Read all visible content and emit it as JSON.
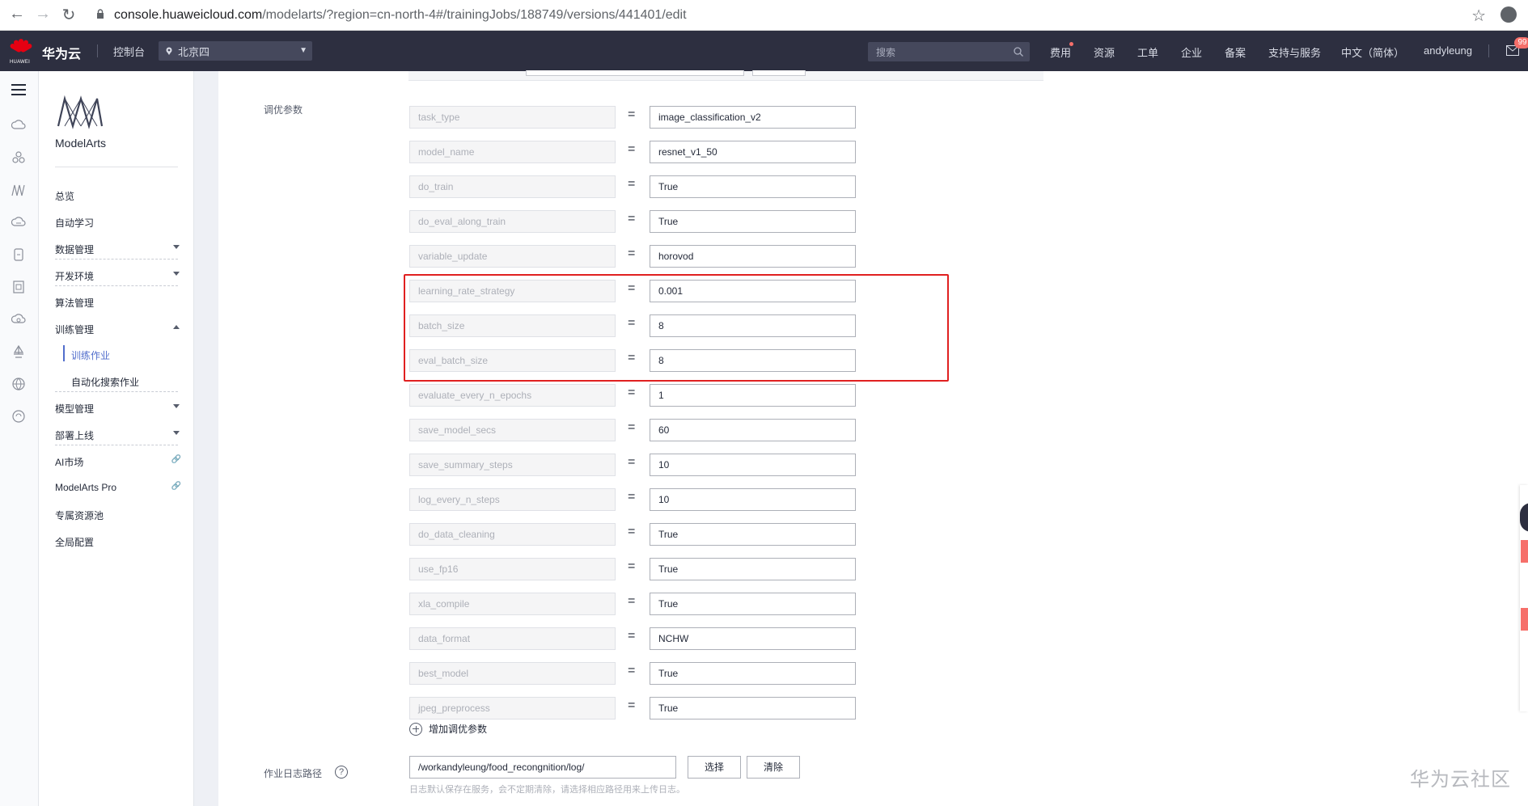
{
  "browser": {
    "url_host": "console.huaweicloud.com",
    "url_path": "/modelarts/?region=cn-north-4#/trainingJobs/188749/versions/441401/edit"
  },
  "header": {
    "logo_text": "HUAWEI",
    "brand": "华为云",
    "console": "控制台",
    "region": "北京四",
    "search_placeholder": "搜索",
    "nav": [
      "费用",
      "资源",
      "工单",
      "企业",
      "备案",
      "支持与服务",
      "中文（简体）",
      "andyleung"
    ],
    "mail_badge": "99"
  },
  "sidebar": {
    "product": "ModelArts",
    "items": [
      {
        "label": "总览"
      },
      {
        "label": "自动学习"
      },
      {
        "label": "数据管理"
      },
      {
        "label": "开发环境"
      },
      {
        "label": "算法管理"
      },
      {
        "label": "训练管理"
      },
      {
        "label": "训练作业"
      },
      {
        "label": "自动化搜索作业"
      },
      {
        "label": "模型管理"
      },
      {
        "label": "部署上线"
      },
      {
        "label": "AI市场"
      },
      {
        "label": "ModelArts Pro"
      },
      {
        "label": "专属资源池"
      },
      {
        "label": "全局配置"
      }
    ]
  },
  "form": {
    "params_label": "调优参数",
    "equals": "=",
    "params": [
      {
        "name": "task_type",
        "value": "image_classification_v2"
      },
      {
        "name": "model_name",
        "value": "resnet_v1_50"
      },
      {
        "name": "do_train",
        "value": "True"
      },
      {
        "name": "do_eval_along_train",
        "value": "True"
      },
      {
        "name": "variable_update",
        "value": "horovod"
      },
      {
        "name": "learning_rate_strategy",
        "value": "0.001"
      },
      {
        "name": "batch_size",
        "value": "8"
      },
      {
        "name": "eval_batch_size",
        "value": "8"
      },
      {
        "name": "evaluate_every_n_epochs",
        "value": "1"
      },
      {
        "name": "save_model_secs",
        "value": "60"
      },
      {
        "name": "save_summary_steps",
        "value": "10"
      },
      {
        "name": "log_every_n_steps",
        "value": "10"
      },
      {
        "name": "do_data_cleaning",
        "value": "True"
      },
      {
        "name": "use_fp16",
        "value": "True"
      },
      {
        "name": "xla_compile",
        "value": "True"
      },
      {
        "name": "data_format",
        "value": "NCHW"
      },
      {
        "name": "best_model",
        "value": "True"
      },
      {
        "name": "jpeg_preprocess",
        "value": "True"
      }
    ],
    "add_param": "增加调优参数",
    "log_path_label": "作业日志路径",
    "help": "?",
    "log_path_value": "/workandyleung/food_recongnition/log/",
    "select_button": "选择",
    "clear_button": "清除",
    "log_hint": "日志默认保存在服务，会不定期清除，请选择相应路径用来上传日志。"
  },
  "watermark": "华为云社区",
  "colors": {
    "header_bg": "#2d2f40",
    "accent": "#526ecc",
    "highlight": "#e02020"
  }
}
